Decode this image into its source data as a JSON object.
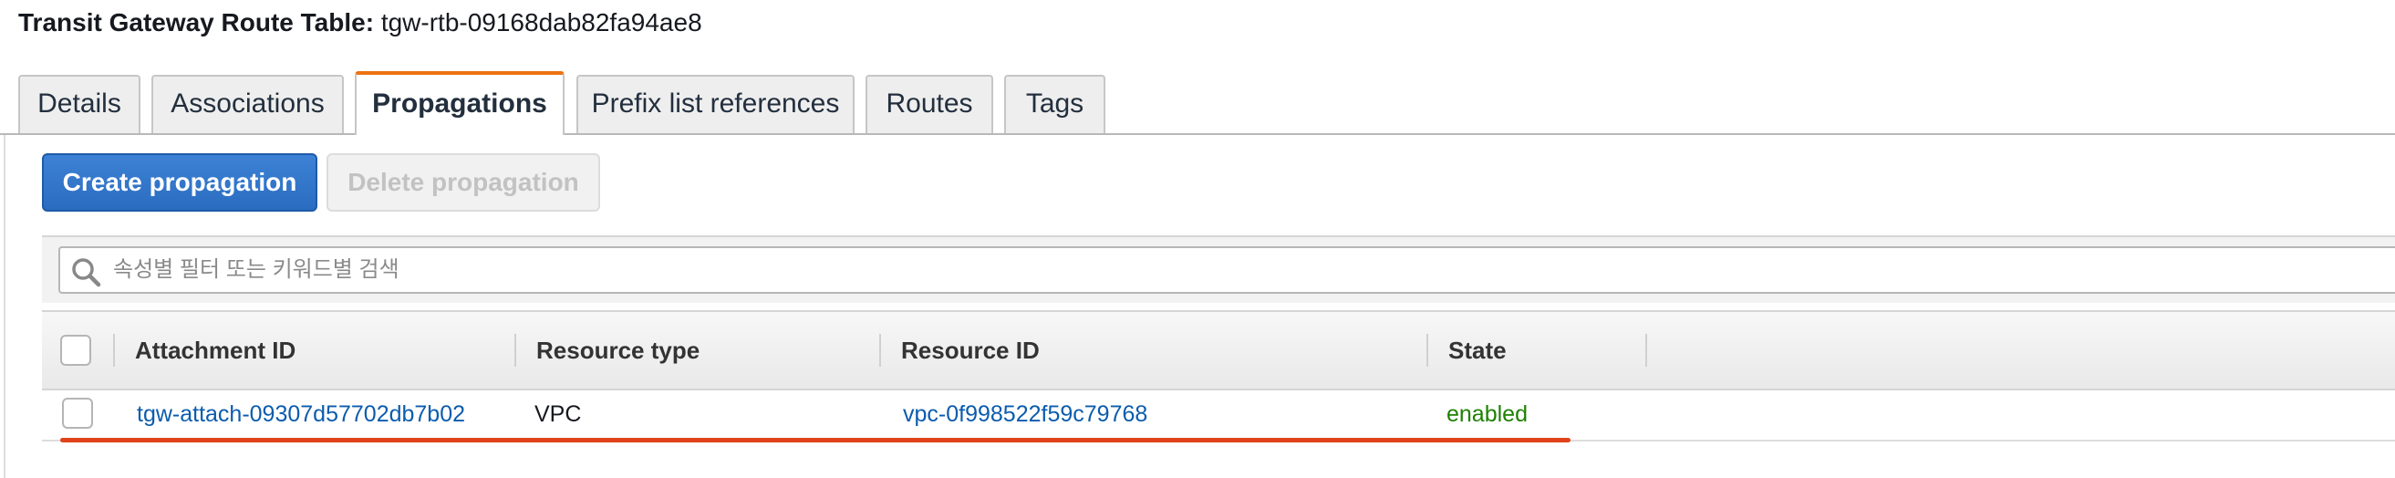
{
  "header": {
    "title_label": "Transit Gateway Route Table:",
    "title_value": "tgw-rtb-09168dab82fa94ae8"
  },
  "tabs": [
    {
      "label": "Details"
    },
    {
      "label": "Associations"
    },
    {
      "label": "Propagations",
      "active": true
    },
    {
      "label": "Prefix list references"
    },
    {
      "label": "Routes"
    },
    {
      "label": "Tags"
    }
  ],
  "toolbar": {
    "create_label": "Create propagation",
    "delete_label": "Delete propagation"
  },
  "search": {
    "placeholder": "속성별 필터 또는 키워드별 검색",
    "icon": "search-icon"
  },
  "table": {
    "columns": [
      "Attachment ID",
      "Resource type",
      "Resource ID",
      "State"
    ],
    "rows": [
      {
        "attachment_id": "tgw-attach-09307d57702db7b02",
        "resource_type": "VPC",
        "resource_id": "vpc-0f998522f59c79768",
        "state": "enabled"
      }
    ]
  },
  "colors": {
    "active_tab_accent": "#ec7211",
    "primary_button": "#2a6cc0",
    "link": "#0b5cad",
    "state_enabled": "#1d8102",
    "annotation_underline": "#e0421b"
  }
}
